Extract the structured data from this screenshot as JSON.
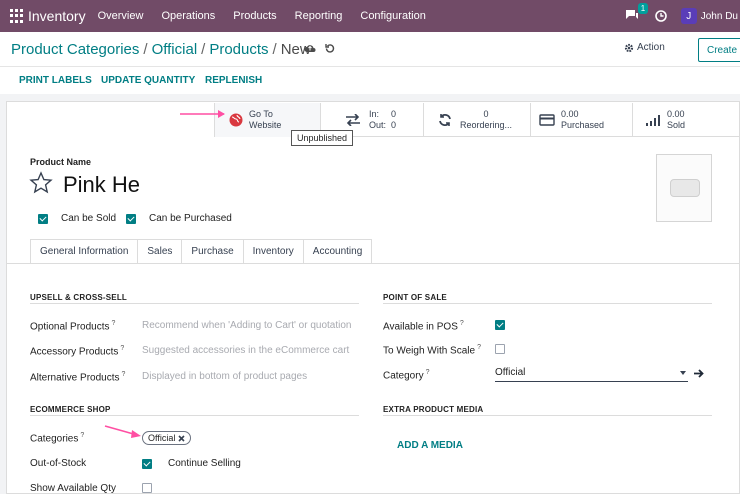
{
  "navbar": {
    "app_name": "Inventory",
    "menu": [
      "Overview",
      "Operations",
      "Products",
      "Reporting",
      "Configuration"
    ],
    "chat_count": "1",
    "user_initial": "J",
    "user_name": "John Du"
  },
  "breadcrumb": [
    "Product Categories",
    "Official",
    "Products",
    "New"
  ],
  "header_actions": {
    "action": "Action",
    "create": "Create"
  },
  "control_buttons": [
    "PRINT LABELS",
    "UPDATE QUANTITY",
    "REPLENISH"
  ],
  "stat_buttons": {
    "website": {
      "line1": "Go To",
      "line2": "Website",
      "tooltip": "Unpublished"
    },
    "inout": {
      "in_label": "In:",
      "in_value": "0",
      "out_label": "Out:",
      "out_value": "0"
    },
    "reordering": {
      "value": "0",
      "label": "Reordering..."
    },
    "purchased": {
      "value": "0.00",
      "label": "Purchased"
    },
    "sold": {
      "value": "0.00",
      "label": "Sold"
    }
  },
  "product": {
    "name_label": "Product Name",
    "name": "Pink He",
    "can_be_sold": {
      "label": "Can be Sold",
      "checked": true
    },
    "can_be_purchased": {
      "label": "Can be Purchased",
      "checked": true
    }
  },
  "tabs": [
    "General Information",
    "Sales",
    "Purchase",
    "Inventory",
    "Accounting"
  ],
  "active_tab": "Sales",
  "upsell": {
    "title": "UPSELL & CROSS-SELL",
    "optional": {
      "label": "Optional Products",
      "placeholder": "Recommend when 'Adding to Cart' or quotation"
    },
    "accessory": {
      "label": "Accessory Products",
      "placeholder": "Suggested accessories in the eCommerce cart"
    },
    "alternative": {
      "label": "Alternative Products",
      "placeholder": "Displayed in bottom of product pages"
    }
  },
  "ecommerce": {
    "title": "ECOMMERCE SHOP",
    "categories_label": "Categories",
    "category_tag": "Official",
    "out_of_stock_label": "Out-of-Stock",
    "continue_selling": {
      "label": "Continue Selling",
      "checked": true
    },
    "show_qty": {
      "label": "Show Available Qty",
      "checked": false
    }
  },
  "pos": {
    "title": "POINT OF SALE",
    "available_in_pos": {
      "label": "Available in POS",
      "checked": true
    },
    "to_weigh": {
      "label": "To Weigh With Scale",
      "checked": false
    },
    "category_label": "Category",
    "category_value": "Official"
  },
  "media": {
    "title": "EXTRA PRODUCT MEDIA",
    "add": "ADD A MEDIA"
  },
  "colors": {
    "brand": "#714B67",
    "accent": "#017e84",
    "annotation_arrow": "#ff4fa3"
  }
}
